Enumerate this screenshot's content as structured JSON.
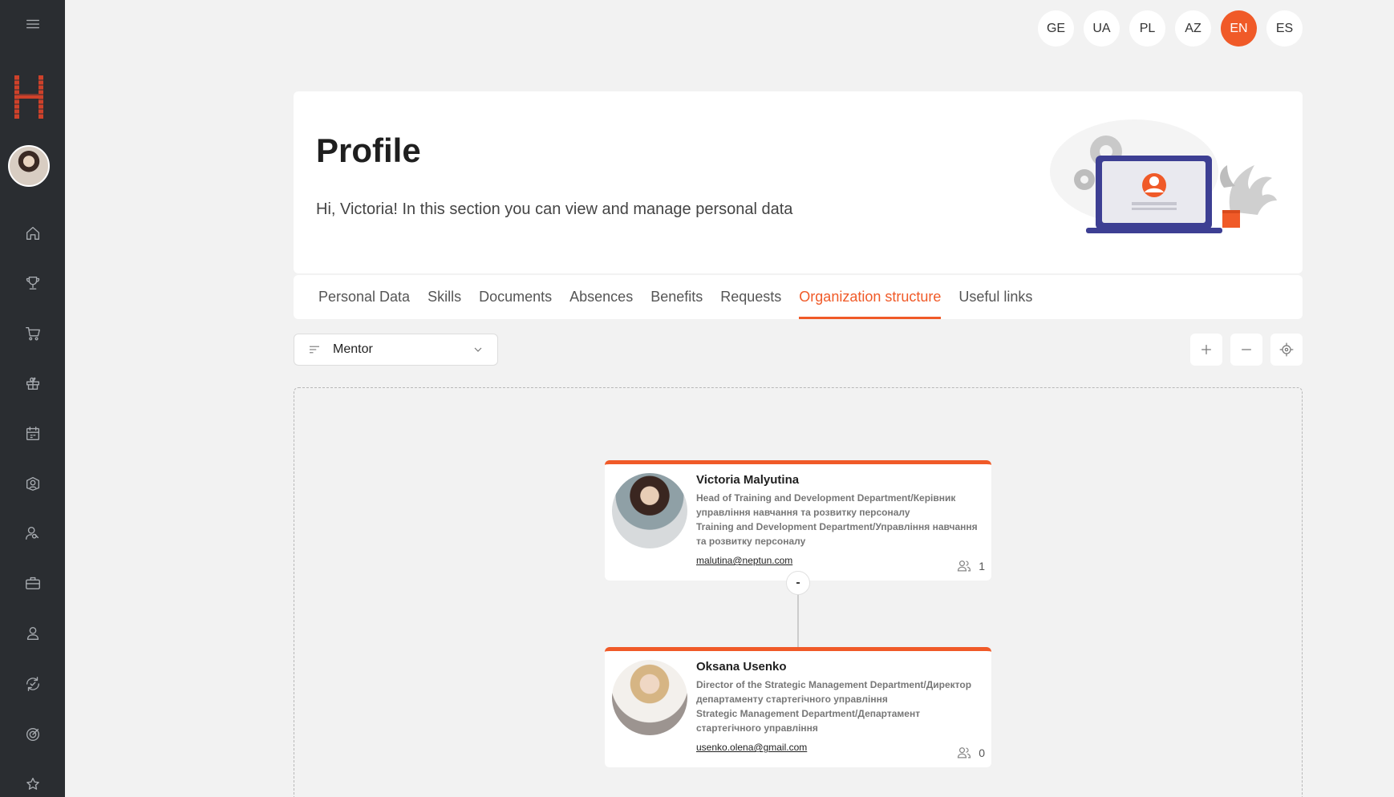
{
  "languages": [
    "GE",
    "UA",
    "PL",
    "AZ",
    "EN",
    "ES"
  ],
  "active_language": "EN",
  "header": {
    "title": "Profile",
    "subtitle": "Hi, Victoria! In this section you can view and manage personal data"
  },
  "tabs": [
    "Personal Data",
    "Skills",
    "Documents",
    "Absences",
    "Benefits",
    "Requests",
    "Organization structure",
    "Useful links"
  ],
  "active_tab": "Organization structure",
  "filter": {
    "value": "Mentor"
  },
  "cards": [
    {
      "name": "Victoria Malyutina",
      "position": "Head of Training and Development Department/Керівник управління навчання та розвитку персоналу",
      "department": "Training and Development Department/Управління навчання та розвитку персоналу",
      "email": "malutina@neptun.com",
      "count": "1"
    },
    {
      "name": "Oksana Usenko",
      "position": "Director of the Strategic Management Department/Директор департаменту стартегічного управління",
      "department": "Strategic Management Department/Департамент стартегічного управління",
      "email": "usenko.olena@gmail.com",
      "count": "0"
    }
  ],
  "toggle_label": "-",
  "colors": {
    "accent": "#f05a28",
    "sidebar": "#2a2d31",
    "background": "#f2f2f2"
  },
  "sidebar_icons": [
    "menu-icon",
    "home-icon",
    "trophy-icon",
    "cart-icon",
    "gift-icon",
    "calendar-icon",
    "book-icon",
    "people-search-icon",
    "briefcase-icon",
    "user-icon",
    "refresh-icon",
    "target-icon",
    "star-icon"
  ]
}
